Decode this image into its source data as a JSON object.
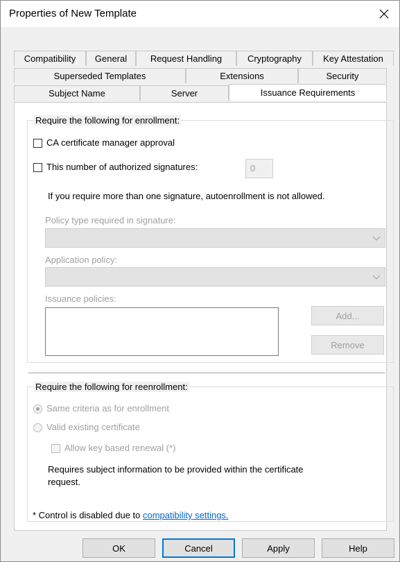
{
  "window": {
    "title": "Properties of New Template",
    "close_glyph": "✕"
  },
  "tabs": {
    "row1": [
      "Compatibility",
      "General",
      "Request Handling",
      "Cryptography",
      "Key Attestation"
    ],
    "row2": [
      "Superseded Templates",
      "Extensions",
      "Security"
    ],
    "row3": [
      "Subject Name",
      "Server",
      "Issuance Requirements"
    ],
    "active": "Issuance Requirements"
  },
  "enrollment": {
    "legend": "Require the following for enrollment:",
    "ca_approval_label": "CA certificate manager approval",
    "ca_approval_checked": false,
    "signatures_label": "This number of authorized signatures:",
    "signatures_checked": false,
    "signatures_value": "0",
    "autoenroll_note": "If you require more than one signature, autoenrollment is not allowed.",
    "policy_type_label": "Policy type required in signature:",
    "policy_type_value": "",
    "app_policy_label": "Application policy:",
    "app_policy_value": "",
    "issuance_policies_label": "Issuance policies:",
    "add_button": "Add...",
    "remove_button": "Remove"
  },
  "reenrollment": {
    "legend": "Require the following for reenrollment:",
    "same_criteria_label": "Same criteria as for enrollment",
    "valid_cert_label": "Valid existing certificate",
    "allow_key_renewal_label": "Allow key based renewal (*)",
    "requires_note_line1": "Requires subject information to be provided within the certificate",
    "requires_note_line2": "request."
  },
  "footnote": {
    "prefix": "* Control is disabled due to ",
    "link": "compatibility settings."
  },
  "buttons": {
    "ok": "OK",
    "cancel": "Cancel",
    "apply": "Apply",
    "help": "Help"
  },
  "colors": {
    "accent": "#0078d7",
    "link": "#0066cc",
    "disabled_text": "#a0a0a0"
  }
}
